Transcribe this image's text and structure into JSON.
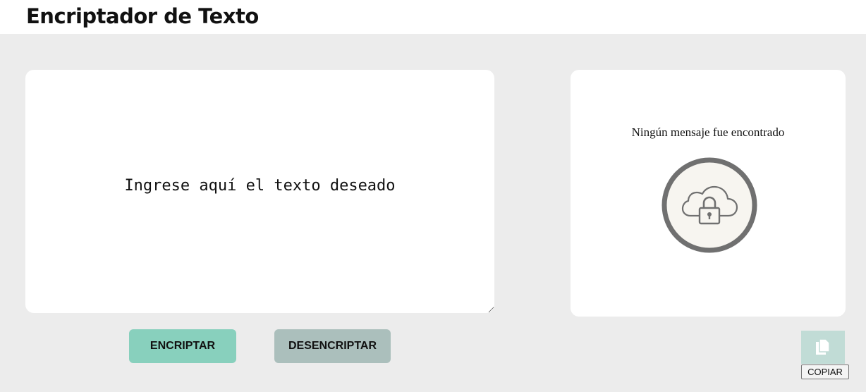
{
  "header": {
    "title": "Encriptador de Texto"
  },
  "input": {
    "placeholder": "Ingrese aquí el texto deseado",
    "value": ""
  },
  "actions": {
    "encrypt_label": "ENCRIPTAR",
    "decrypt_label": "DESENCRIPTAR"
  },
  "output": {
    "empty_message": "Ningún mensaje fue encontrado",
    "illustration_icon": "cloud-lock-icon"
  },
  "copy": {
    "icon": "copy-icon",
    "label": "COPIAR"
  },
  "colors": {
    "background": "#ececec",
    "encrypt_button": "#88d0bd",
    "decrypt_button": "#abbfbc",
    "copy_button": "#c1dcd6",
    "illustration_ring": "#707070",
    "illustration_fill": "#f7f5f0"
  }
}
